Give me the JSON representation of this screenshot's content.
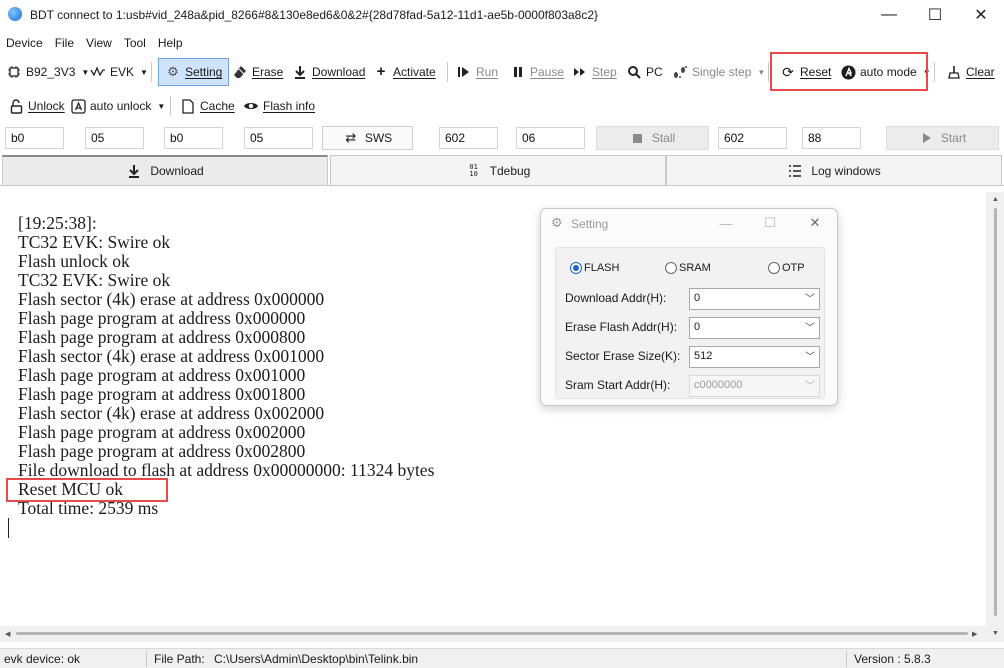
{
  "window": {
    "title": "BDT connect to 1:usb#vid_248a&pid_8266#8&130e8ed6&0&2#{28d78fad-5a12-11d1-ae5b-0000f803a8c2}",
    "minimize": "—",
    "maximize": "☐",
    "close": "✕"
  },
  "menu": [
    "Device",
    "File",
    "View",
    "Tool",
    "Help"
  ],
  "toolbar1": {
    "chip": "B92_3V3",
    "board": "EVK",
    "setting": "Setting",
    "erase": "Erase",
    "download": "Download",
    "activate": "Activate",
    "run": "Run",
    "pause": "Pause",
    "step": "Step",
    "pc": "PC",
    "single_step": "Single step",
    "reset": "Reset",
    "auto_mode": "auto mode",
    "clear": "Clear"
  },
  "toolbar2": {
    "unlock": "Unlock",
    "auto_unlock": "auto unlock",
    "cache": "Cache",
    "flash_info": "Flash info"
  },
  "inputs_row": {
    "field1": "b0",
    "field2": "05",
    "field3": "b0",
    "field4": "05",
    "sws": "SWS",
    "field5": "602",
    "field6": "06",
    "stall": "Stall",
    "field7": "602",
    "field8": "88",
    "start": "Start"
  },
  "tabs": {
    "download": "Download",
    "tdebug": "Tdebug",
    "log_windows": "Log windows"
  },
  "log": [
    "[19:25:38]:",
    "TC32 EVK: Swire ok",
    "Flash unlock ok",
    "TC32 EVK: Swire ok",
    "Flash sector (4k) erase at address 0x000000",
    "Flash page program at address 0x000000",
    "Flash page program at address 0x000800",
    "Flash sector (4k) erase at address 0x001000",
    "Flash page program at address 0x001000",
    "Flash page program at address 0x001800",
    "Flash sector (4k) erase at address 0x002000",
    "Flash page program at address 0x002000",
    "Flash page program at address 0x002800",
    "File download to flash at address 0x00000000: 11324 bytes",
    "Reset MCU ok",
    "Total time: 2539 ms"
  ],
  "status": {
    "device": "evk device: ok",
    "file_path_label": "File Path:",
    "file_path": "C:\\Users\\Admin\\Desktop\\bin\\Telink.bin",
    "version": "Version : 5.8.3"
  },
  "setting_dialog": {
    "title": "Setting",
    "memory_options": [
      "FLASH",
      "SRAM",
      "OTP"
    ],
    "selected_memory": "FLASH",
    "download_addr_label": "Download  Addr(H):",
    "download_addr": "0",
    "erase_addr_label": "Erase Flash Addr(H):",
    "erase_addr": "0",
    "sector_size_label": "Sector Erase Size(K):",
    "sector_size": "512",
    "sram_addr_label": "Sram Start Addr(H):",
    "sram_addr": "c0000000"
  },
  "colors": {
    "highlight_box": "#e64a4a",
    "setting_active_bg": "#cfe4fb",
    "radio_selected": "#1a66c9"
  }
}
